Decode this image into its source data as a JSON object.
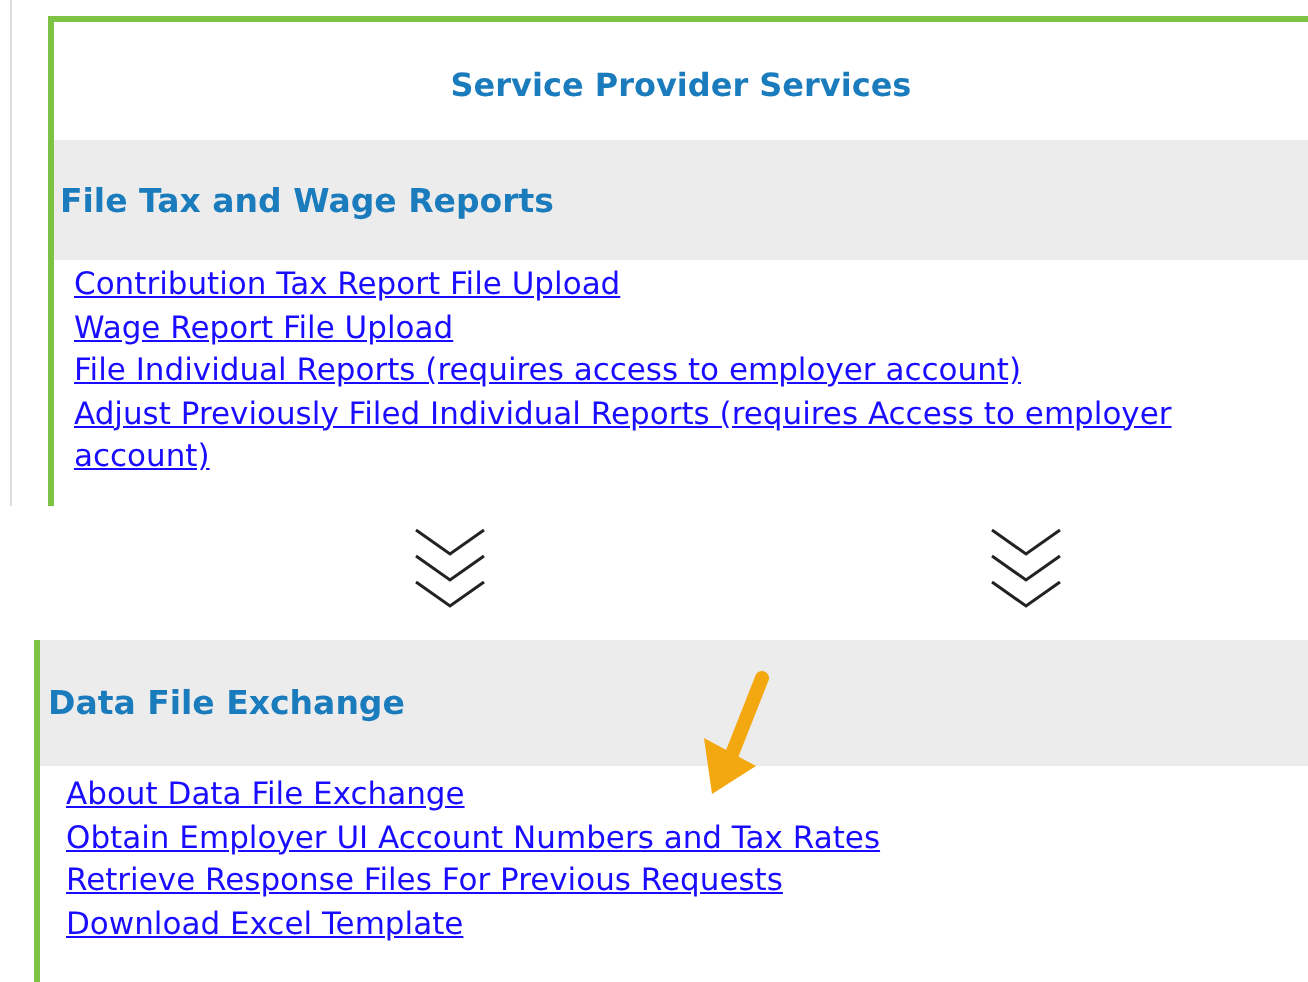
{
  "top_panel": {
    "title": "Service Provider Services",
    "section": {
      "heading": "File Tax and Wage Reports",
      "links": [
        "Contribution Tax Report File Upload",
        "Wage Report File Upload",
        "File Individual Reports (requires access to employer account)",
        "Adjust Previously Filed Individual Reports (requires Access to employer account)"
      ]
    }
  },
  "bottom_panel": {
    "section": {
      "heading": "Data File Exchange",
      "links": [
        "About Data File Exchange",
        "Obtain Employer UI Account Numbers and Tax Rates",
        "Retrieve Response Files For Previous Requests",
        "Download Excel Template"
      ]
    }
  }
}
